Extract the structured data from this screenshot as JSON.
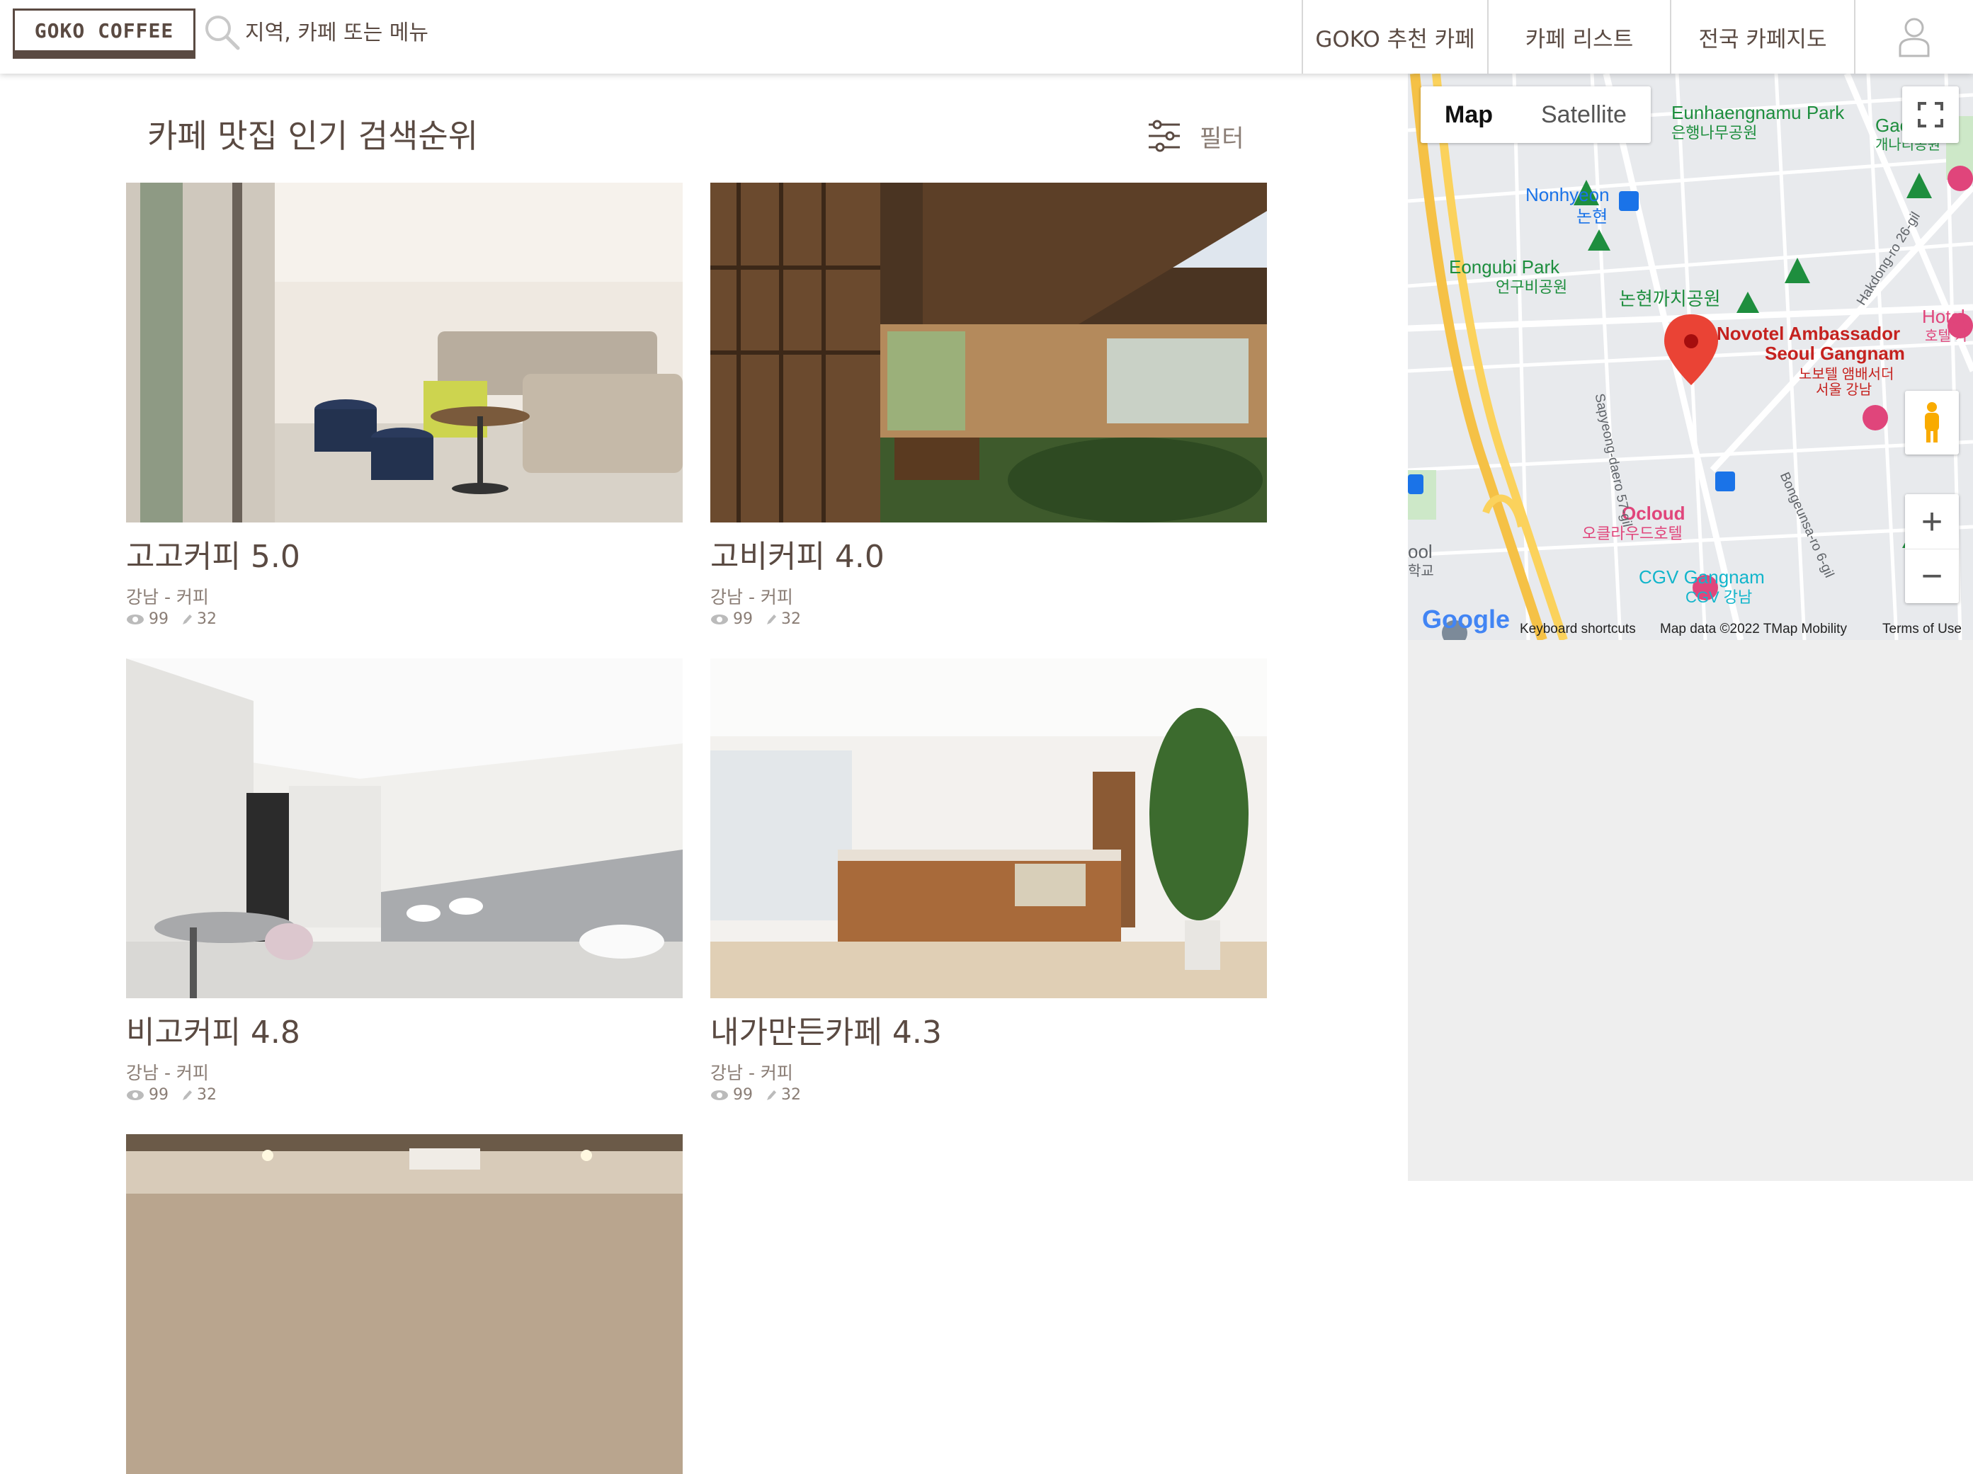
{
  "header": {
    "logo_text": "GOKO COFFEE",
    "search_placeholder": "지역, 카페 또는 메뉴",
    "nav": [
      "GOKO 추천 카페",
      "카페 리스트",
      "전국 카페지도"
    ]
  },
  "main": {
    "section_title": "카페 맛집 인기 검색순위",
    "filter_label": "필터",
    "cards": [
      {
        "title": "고고커피 5.0",
        "location": "강남 - 커피",
        "views": "99",
        "reviews": "32"
      },
      {
        "title": "고비커피 4.0",
        "location": "강남 - 커피",
        "views": "99",
        "reviews": "32"
      },
      {
        "title": "비고커피 4.8",
        "location": "강남 - 커피",
        "views": "99",
        "reviews": "32"
      },
      {
        "title": "내가만든카페 4.3",
        "location": "강남 - 커피",
        "views": "99",
        "reviews": "32"
      }
    ]
  },
  "map": {
    "type_map": "Map",
    "type_satellite": "Satellite",
    "zoom_in": "+",
    "zoom_out": "−",
    "labels": {
      "eunhaengnamu_en": "Eunhaengnamu Park",
      "eunhaengnamu_ko": "은행나무공원",
      "gae": "Gae",
      "gae_ko": "개나리공원",
      "nonhyeon_en": "Nonhyeon",
      "nonhyeon_ko": "논현",
      "eongubi_en": "Eongubi Park",
      "eongubi_ko": "언구비공원",
      "kkachi_ko": "논현까치공원",
      "novotel_en1": "Novotel Ambassador",
      "novotel_en2": "Seoul Gangnam",
      "novotel_ko1": "노보텔 앰배서더",
      "novotel_ko2": "서울 강남",
      "hotel": "Hotel",
      "hotel_ko": "호텔 카",
      "ocloud_en": "Ocloud",
      "ocloud_ko": "오클라우드호텔",
      "cgv_en": "CGV Gangnam",
      "cgv_ko": "CGV 강남",
      "school_en": "ool",
      "school_ko": "학교",
      "road_sapyeong": "Sapyeong-daero 57-gil",
      "road_bongeunsa": "Bongeunsa-ro 6-gil",
      "road_hakdong": "Hakdong-ro 26-gil"
    },
    "footer": {
      "keyboard": "Keyboard shortcuts",
      "data": "Map data ©2022 TMap Mobility",
      "terms": "Terms of Use"
    },
    "google_logo": "Google"
  },
  "colors": {
    "brand": "#5a4a42",
    "muted": "#8a7d75",
    "map_road_major": "#fbd25c",
    "map_pin": "#ea4335",
    "map_park": "#1e8e3e",
    "map_hotel": "#e0457b",
    "map_transit": "#1a73e8"
  }
}
